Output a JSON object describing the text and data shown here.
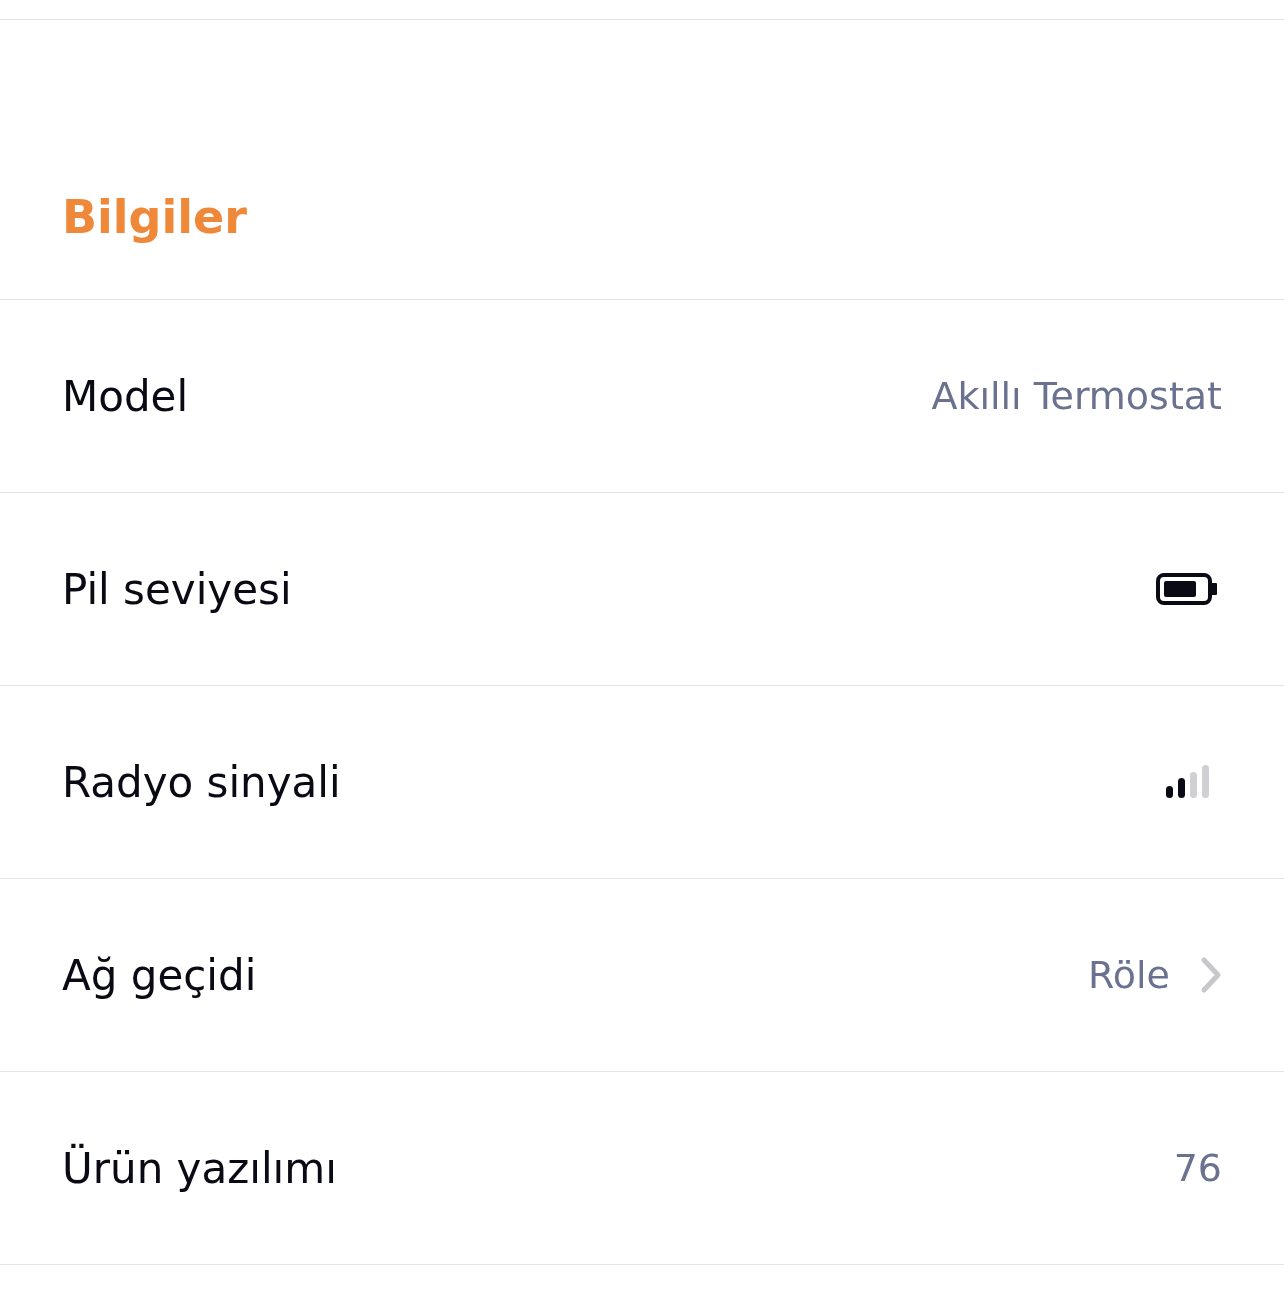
{
  "section": {
    "title": "Bilgiler"
  },
  "rows": [
    {
      "label": "Model",
      "kind": "text",
      "value": "Akıllı Termostat"
    },
    {
      "label": "Pil seviyesi",
      "kind": "battery"
    },
    {
      "label": "Radyo sinyali",
      "kind": "signal"
    },
    {
      "label": "Ağ geçidi",
      "kind": "link",
      "value": "Röle"
    },
    {
      "label": "Ürün yazılımı",
      "kind": "text",
      "value": "76"
    }
  ]
}
